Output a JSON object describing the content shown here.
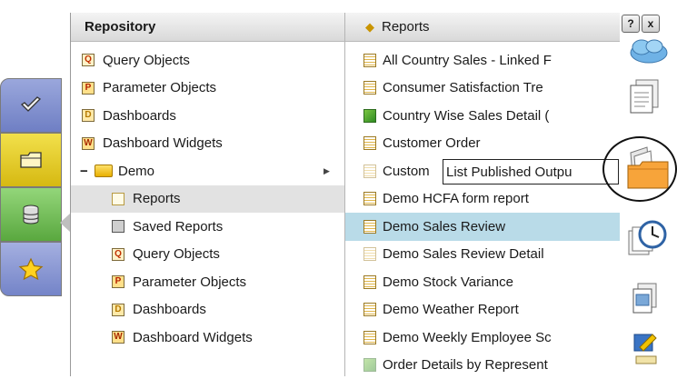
{
  "repository": {
    "title": "Repository",
    "items": [
      {
        "label": "Query Objects",
        "icon": "query-object-icon",
        "glyph": "Q",
        "kind": "q"
      },
      {
        "label": "Parameter Objects",
        "icon": "parameter-object-icon",
        "glyph": "P",
        "kind": "p"
      },
      {
        "label": "Dashboards",
        "icon": "dashboard-icon",
        "glyph": "D",
        "kind": "d"
      },
      {
        "label": "Dashboard Widgets",
        "icon": "dashboard-widget-icon",
        "glyph": "W",
        "kind": "w"
      }
    ],
    "demo_folder": {
      "label": "Demo",
      "toggle": "−"
    },
    "demo_items": [
      {
        "label": "Reports",
        "icon": "reports-icon",
        "glyph": "",
        "kind": "rep",
        "selected": true
      },
      {
        "label": "Saved Reports",
        "icon": "saved-reports-icon",
        "glyph": "",
        "kind": "sav"
      },
      {
        "label": "Query Objects",
        "icon": "query-object-icon",
        "glyph": "Q",
        "kind": "q"
      },
      {
        "label": "Parameter Objects",
        "icon": "parameter-object-icon",
        "glyph": "P",
        "kind": "p"
      },
      {
        "label": "Dashboards",
        "icon": "dashboard-icon",
        "glyph": "D",
        "kind": "d"
      },
      {
        "label": "Dashboard Widgets",
        "icon": "dashboard-widget-icon",
        "glyph": "W",
        "kind": "w"
      }
    ]
  },
  "reports": {
    "title": "Reports",
    "items": [
      {
        "label": "All Country Sales - Linked F",
        "style": ""
      },
      {
        "label": "Consumer Satisfaction Tre",
        "style": ""
      },
      {
        "label": "Country Wise Sales Detail (",
        "style": "green"
      },
      {
        "label": "Customer Order",
        "style": ""
      },
      {
        "label": "Custom",
        "style": "faded"
      },
      {
        "label": "Demo HCFA form report",
        "style": ""
      },
      {
        "label": "Demo Sales Review",
        "style": "",
        "selected": true
      },
      {
        "label": "Demo Sales Review Detail",
        "style": "faded"
      },
      {
        "label": "Demo Stock Variance",
        "style": ""
      },
      {
        "label": "Demo Weather Report",
        "style": ""
      },
      {
        "label": "Demo Weekly Employee Sc",
        "style": ""
      },
      {
        "label": "Order Details by Represent",
        "style": "green faded"
      }
    ]
  },
  "tooltip": {
    "text": "List Published Outpu"
  },
  "window": {
    "help_label": "?",
    "close_label": "x"
  },
  "toolbar": {
    "icons": [
      "cloud-icon",
      "documents-icon",
      "folder-icon",
      "schedule-clock-icon",
      "report-document-icon",
      "pen-icon"
    ]
  },
  "side_tabs": [
    "check-tab-icon",
    "folder-tab-icon",
    "database-tab-icon",
    "star-tab-icon"
  ]
}
